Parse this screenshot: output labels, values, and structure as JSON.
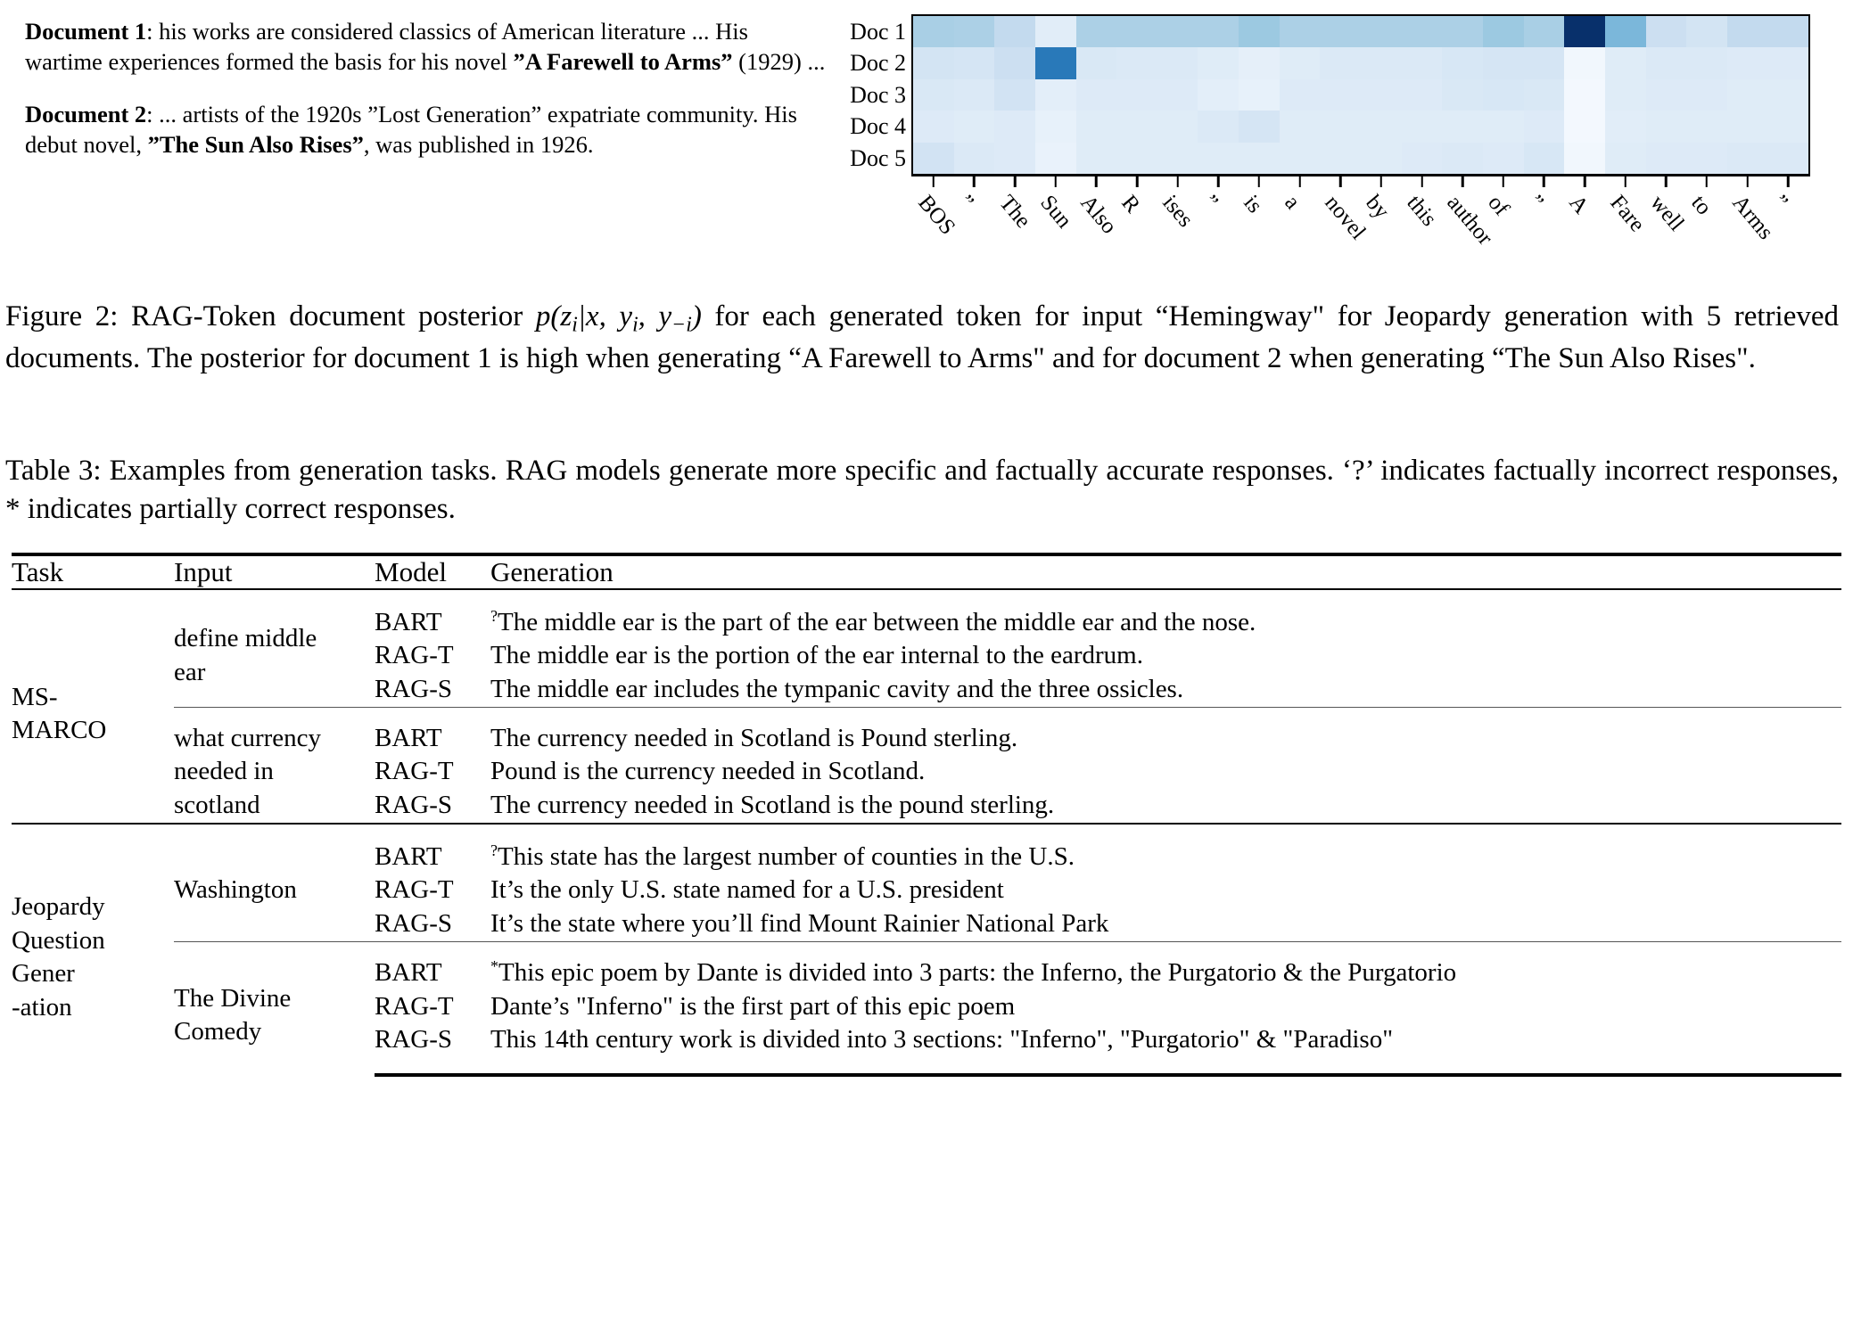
{
  "documents": [
    {
      "label": "Document 1",
      "parts": [
        {
          "t": ": his works are considered classics of American literature ... His wartime experiences formed the basis for his novel ",
          "b": false
        },
        {
          "t": "”A Farewell to Arms”",
          "b": true
        },
        {
          "t": " (1929) ...",
          "b": false
        }
      ]
    },
    {
      "label": "Document 2",
      "parts": [
        {
          "t": ": ... artists of the 1920s ”Lost Generation” expatriate community. His debut novel, ",
          "b": false
        },
        {
          "t": "”The Sun Also Rises”",
          "b": true
        },
        {
          "t": ", was published in 1926.",
          "b": false
        }
      ]
    }
  ],
  "chart_data": {
    "type": "heatmap",
    "title": "",
    "xlabel": "",
    "ylabel": "",
    "colormap": "Blues",
    "grid": false,
    "legend": "none",
    "row_labels": [
      "Doc 1",
      "Doc 2",
      "Doc 3",
      "Doc 4",
      "Doc 5"
    ],
    "categories": [
      "BOS",
      "”",
      "The",
      "Sun",
      "Also",
      "R",
      "ises",
      "”",
      "is",
      "a",
      "novel",
      "by",
      "this",
      "author",
      "of",
      "”",
      "A",
      "Fare",
      "well",
      "to",
      "Arms",
      "”"
    ],
    "zlim": [
      0,
      1
    ],
    "values": [
      [
        0.34,
        0.33,
        0.26,
        0.11,
        0.33,
        0.33,
        0.33,
        0.33,
        0.38,
        0.33,
        0.33,
        0.33,
        0.33,
        0.33,
        0.38,
        0.34,
        1.0,
        0.46,
        0.22,
        0.18,
        0.26,
        0.26
      ],
      [
        0.18,
        0.17,
        0.22,
        0.72,
        0.15,
        0.14,
        0.14,
        0.12,
        0.09,
        0.12,
        0.14,
        0.14,
        0.14,
        0.16,
        0.17,
        0.17,
        0.03,
        0.12,
        0.14,
        0.14,
        0.13,
        0.13
      ],
      [
        0.15,
        0.14,
        0.19,
        0.1,
        0.13,
        0.13,
        0.13,
        0.1,
        0.08,
        0.13,
        0.13,
        0.13,
        0.13,
        0.15,
        0.16,
        0.15,
        0.02,
        0.12,
        0.13,
        0.13,
        0.12,
        0.12
      ],
      [
        0.13,
        0.12,
        0.13,
        0.08,
        0.12,
        0.12,
        0.12,
        0.14,
        0.17,
        0.12,
        0.12,
        0.12,
        0.12,
        0.12,
        0.12,
        0.13,
        0.02,
        0.11,
        0.12,
        0.12,
        0.12,
        0.12
      ],
      [
        0.19,
        0.14,
        0.13,
        0.07,
        0.12,
        0.12,
        0.12,
        0.12,
        0.12,
        0.12,
        0.12,
        0.12,
        0.13,
        0.14,
        0.13,
        0.16,
        0.03,
        0.12,
        0.13,
        0.13,
        0.14,
        0.14
      ]
    ]
  },
  "figure_caption": {
    "prefix": "Figure 2: RAG-Token document posterior ",
    "formula_p": "p",
    "formula_open": "(",
    "formula_z": "z",
    "formula_zsub": "i",
    "formula_bar": "|",
    "formula_x": "x",
    "formula_comma1": ", ",
    "formula_y1": "y",
    "formula_y1sub": "i",
    "formula_comma2": ", ",
    "formula_y2": "y",
    "formula_y2sub": "−i",
    "formula_close": ")",
    "suffix": " for each generated token for input “Hemingway\" for Jeopardy generation with 5 retrieved documents. The posterior for document 1 is high when generating “A Farewell to Arms\" and for document 2 when generating “The Sun Also Rises\"."
  },
  "table_caption": "Table 3: Examples from generation tasks. RAG models generate more specific and factually accurate responses. ‘?’ indicates factually incorrect responses, * indicates partially correct responses.",
  "table": {
    "headers": [
      "Task",
      "Input",
      "Model",
      "Generation"
    ],
    "groups": [
      {
        "task": "MS-\nMARCO",
        "task_lines": [
          "MS-",
          "MARCO"
        ],
        "blocks": [
          {
            "input_lines": [
              "define middle",
              "ear"
            ],
            "rows": [
              {
                "model": "BART",
                "mark": "?",
                "text": "The middle ear is the part of the ear between the middle ear and the nose."
              },
              {
                "model": "RAG-T",
                "mark": "",
                "text": "The middle ear is the portion of the ear internal to the eardrum."
              },
              {
                "model": "RAG-S",
                "mark": "",
                "text": "The middle ear includes the tympanic cavity and the three ossicles."
              }
            ]
          },
          {
            "input_lines": [
              "what currency",
              "needed in",
              "scotland"
            ],
            "rows": [
              {
                "model": "BART",
                "mark": "",
                "text": "The currency needed in Scotland is Pound sterling."
              },
              {
                "model": "RAG-T",
                "mark": "",
                "text": "Pound is the currency needed in Scotland."
              },
              {
                "model": "RAG-S",
                "mark": "",
                "text": "The currency needed in Scotland is the pound sterling."
              }
            ]
          }
        ]
      },
      {
        "task": "Jeopardy Question Gener -ation",
        "task_lines": [
          "Jeopardy",
          "Question",
          "Gener",
          "-ation"
        ],
        "blocks": [
          {
            "input_lines": [
              "Washington"
            ],
            "rows": [
              {
                "model": "BART",
                "mark": "?",
                "text": "This state has the largest number of counties in the U.S."
              },
              {
                "model": "RAG-T",
                "mark": "",
                "text": "It’s the only U.S. state named for a U.S. president"
              },
              {
                "model": "RAG-S",
                "mark": "",
                "text": "It’s the state where you’ll find Mount Rainier National Park"
              }
            ]
          },
          {
            "input_lines": [
              "The Divine",
              "Comedy"
            ],
            "rows": [
              {
                "model": "BART",
                "mark": "*",
                "text": "This epic poem by Dante is divided into 3 parts: the Inferno, the Purgatorio & the Purgatorio"
              },
              {
                "model": "RAG-T",
                "mark": "",
                "text": "Dante’s \"Inferno\" is the first part of this epic poem"
              },
              {
                "model": "RAG-S",
                "mark": "",
                "text": "This 14th century work is divided into 3 sections: \"Inferno\", \"Purgatorio\" & \"Paradiso\""
              }
            ]
          }
        ]
      }
    ]
  }
}
